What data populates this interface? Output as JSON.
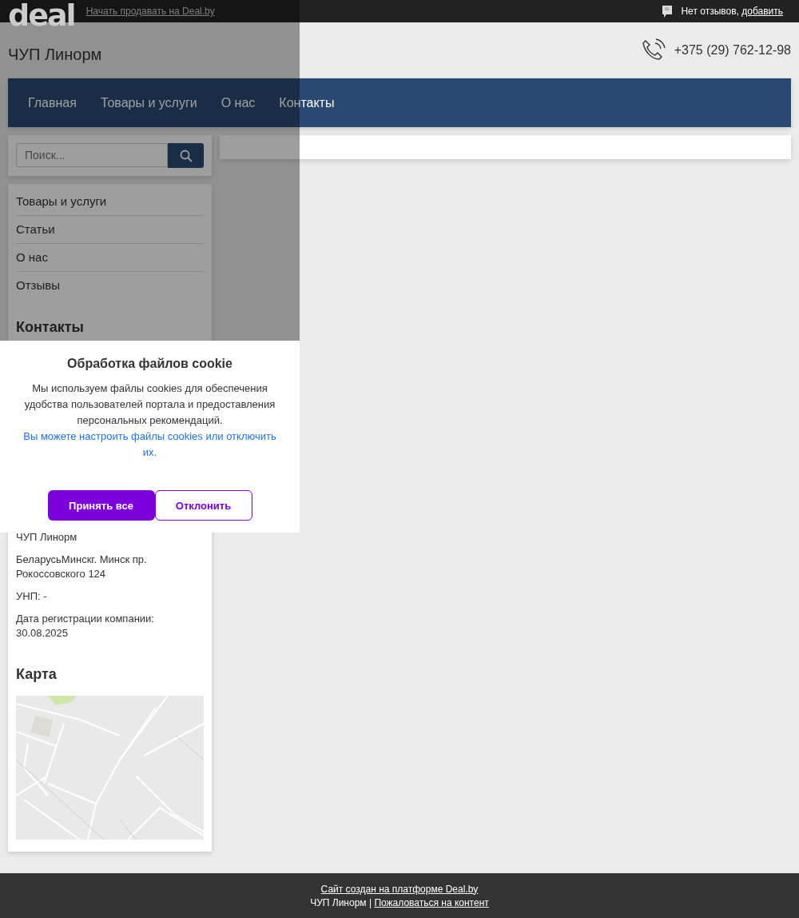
{
  "top_bar": {
    "logo": "deal",
    "sell_link": "Начать продавать на Deal.by",
    "reviews_text": "Нет отзывов, ",
    "reviews_link": "добавить"
  },
  "header": {
    "company": "ЧУП Линорм",
    "phone": "+375 (29) 762-12-98"
  },
  "nav": [
    "Главная",
    "Товары и услуги",
    "О нас",
    "Контакты"
  ],
  "search": {
    "placeholder": "Поиск..."
  },
  "sidebar": {
    "menu": [
      "Товары и услуги",
      "Статьи",
      "О нас",
      "Отзывы"
    ],
    "contacts_title": "Контакты",
    "contacts": [
      "ЧУП Линорм",
      "БеларусьМинскг. Минск пр. Рокоссовского 124",
      "УНП: -",
      "Дата регистрации компании: 30.08.2025"
    ],
    "map_title": "Карта"
  },
  "cookie": {
    "title": "Обработка файлов cookie",
    "text": "Мы используем файлы cookies для обеспечения удобства пользователей портала и предоставления персональных рекомендаций. ",
    "link": "Вы можете настроить файлы cookies или отключить их.",
    "accept": "Принять все",
    "decline": "Отклонить"
  },
  "footer": {
    "platform_link": "Сайт создан на платформе Deal.by",
    "company": "ЧУП Линорм |",
    "report_link": "Пожаловаться на контент"
  }
}
